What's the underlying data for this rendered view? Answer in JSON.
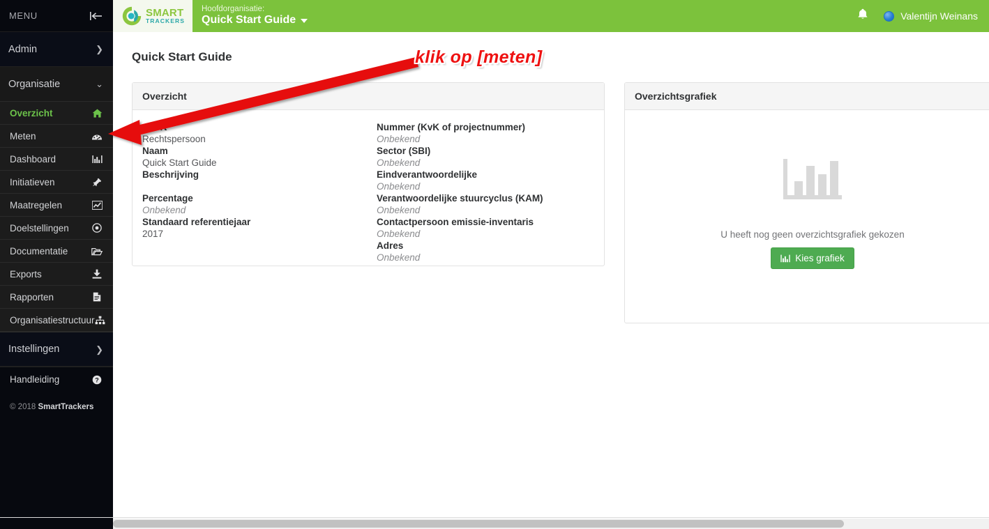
{
  "brand": {
    "logo_line1": "SMART",
    "logo_line2": "TRACKERS",
    "accent_green": "#7cc23c",
    "active_green": "#6cc24a",
    "button_green": "#4eab51",
    "annotation_red": "#ee1111"
  },
  "sidebar": {
    "menu_label": "MENU",
    "collapse_icon": "collapse-left-icon",
    "admin": {
      "label": "Admin",
      "chevron": "chevron-right-icon"
    },
    "group": {
      "label": "Organisatie",
      "chevron": "chevron-down-icon"
    },
    "items": [
      {
        "label": "Overzicht",
        "icon": "home-icon",
        "active": true
      },
      {
        "label": "Meten",
        "icon": "gauge-icon",
        "active": false
      },
      {
        "label": "Dashboard",
        "icon": "bar-chart-icon",
        "active": false
      },
      {
        "label": "Initiatieven",
        "icon": "thumbtack-icon",
        "active": false
      },
      {
        "label": "Maatregelen",
        "icon": "line-chart-icon",
        "active": false
      },
      {
        "label": "Doelstellingen",
        "icon": "target-icon",
        "active": false
      },
      {
        "label": "Documentatie",
        "icon": "folder-open-icon",
        "active": false
      },
      {
        "label": "Exports",
        "icon": "download-icon",
        "active": false
      },
      {
        "label": "Rapporten",
        "icon": "document-icon",
        "active": false
      },
      {
        "label": "Organisatiestructuur",
        "icon": "sitemap-icon",
        "active": false
      }
    ],
    "settings": {
      "label": "Instellingen",
      "chevron": "chevron-right-icon"
    },
    "help": {
      "label": "Handleiding",
      "icon": "question-circle-icon"
    },
    "copyright_prefix": "© 2018 ",
    "copyright_brand": "SmartTrackers"
  },
  "topbar": {
    "org_sub_label": "Hoofdorganisatie:",
    "org_name": "Quick Start Guide",
    "org_caret": "caret-down-icon",
    "notifications_icon": "bell-icon",
    "user_name": "Valentijn Weinans",
    "avatar": "user-avatar"
  },
  "main": {
    "page_title": "Quick Start Guide",
    "overzicht": {
      "panel_title": "Overzicht",
      "left_fields": [
        {
          "label": "Soort",
          "value": "Rechtspersoon",
          "unknown": false
        },
        {
          "label": "Naam",
          "value": "Quick Start Guide",
          "unknown": false
        },
        {
          "label": "Beschrijving",
          "value": "",
          "unknown": false
        },
        {
          "label": "Percentage",
          "value": "Onbekend",
          "unknown": true
        },
        {
          "label": "Standaard referentiejaar",
          "value": "2017",
          "unknown": false
        }
      ],
      "right_fields": [
        {
          "label": "Nummer (KvK of projectnummer)",
          "value": "Onbekend",
          "unknown": true
        },
        {
          "label": "Sector (SBI)",
          "value": "Onbekend",
          "unknown": true
        },
        {
          "label": "Eindverantwoordelijke",
          "value": "Onbekend",
          "unknown": true
        },
        {
          "label": "Verantwoordelijke stuurcyclus (KAM)",
          "value": "Onbekend",
          "unknown": true
        },
        {
          "label": "Contactpersoon emissie-inventaris",
          "value": "Onbekend",
          "unknown": true
        },
        {
          "label": "Adres",
          "value": "Onbekend",
          "unknown": true
        }
      ]
    },
    "grafiek": {
      "panel_title": "Overzichtsgrafiek",
      "placeholder_icon": "bar-chart-placeholder-icon",
      "empty_message": "U heeft nog geen overzichtsgrafiek gekozen",
      "button_label": "Kies grafiek",
      "button_icon": "bar-chart-icon"
    }
  },
  "annotation": {
    "text": "klik op [meten]",
    "arrow": "red-arrow-pointing-to-meten"
  }
}
